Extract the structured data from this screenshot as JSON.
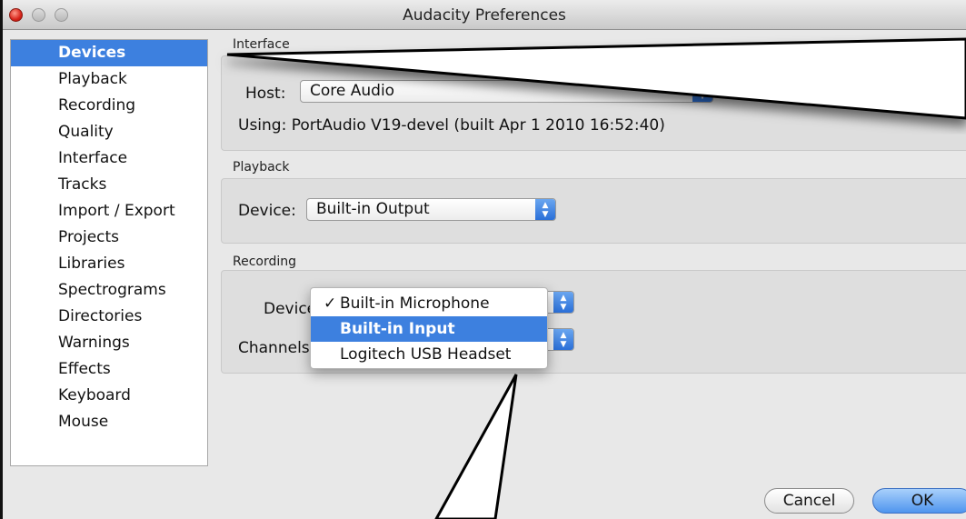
{
  "window": {
    "title": "Audacity Preferences"
  },
  "sidebar": {
    "items": [
      {
        "label": "Devices",
        "selected": true
      },
      {
        "label": "Playback"
      },
      {
        "label": "Recording"
      },
      {
        "label": "Quality"
      },
      {
        "label": "Interface"
      },
      {
        "label": "Tracks"
      },
      {
        "label": "Import / Export"
      },
      {
        "label": "Projects"
      },
      {
        "label": "Libraries"
      },
      {
        "label": "Spectrograms"
      },
      {
        "label": "Directories"
      },
      {
        "label": "Warnings"
      },
      {
        "label": "Effects"
      },
      {
        "label": "Keyboard"
      },
      {
        "label": "Mouse"
      }
    ]
  },
  "interface": {
    "section_label": "Interface",
    "host_label": "Host:",
    "host_value": "Core Audio",
    "using_text": "Using: PortAudio V19-devel (built Apr  1 2010 16:52:40)"
  },
  "playback": {
    "section_label": "Playback",
    "device_label": "Device:",
    "device_value": "Built-in Output"
  },
  "recording": {
    "section_label": "Recording",
    "device_label": "Device",
    "channels_label": "Channels",
    "device_menu": {
      "options": [
        "Built-in Microphone",
        "Built-in Input",
        "Logitech USB Headset"
      ],
      "checked": "Built-in Microphone",
      "highlighted": "Built-in Input",
      "check_mark": "✓"
    }
  },
  "buttons": {
    "cancel": "Cancel",
    "ok": "OK"
  },
  "colors": {
    "selection": "#3d80df",
    "close_button": "#d7241a"
  }
}
